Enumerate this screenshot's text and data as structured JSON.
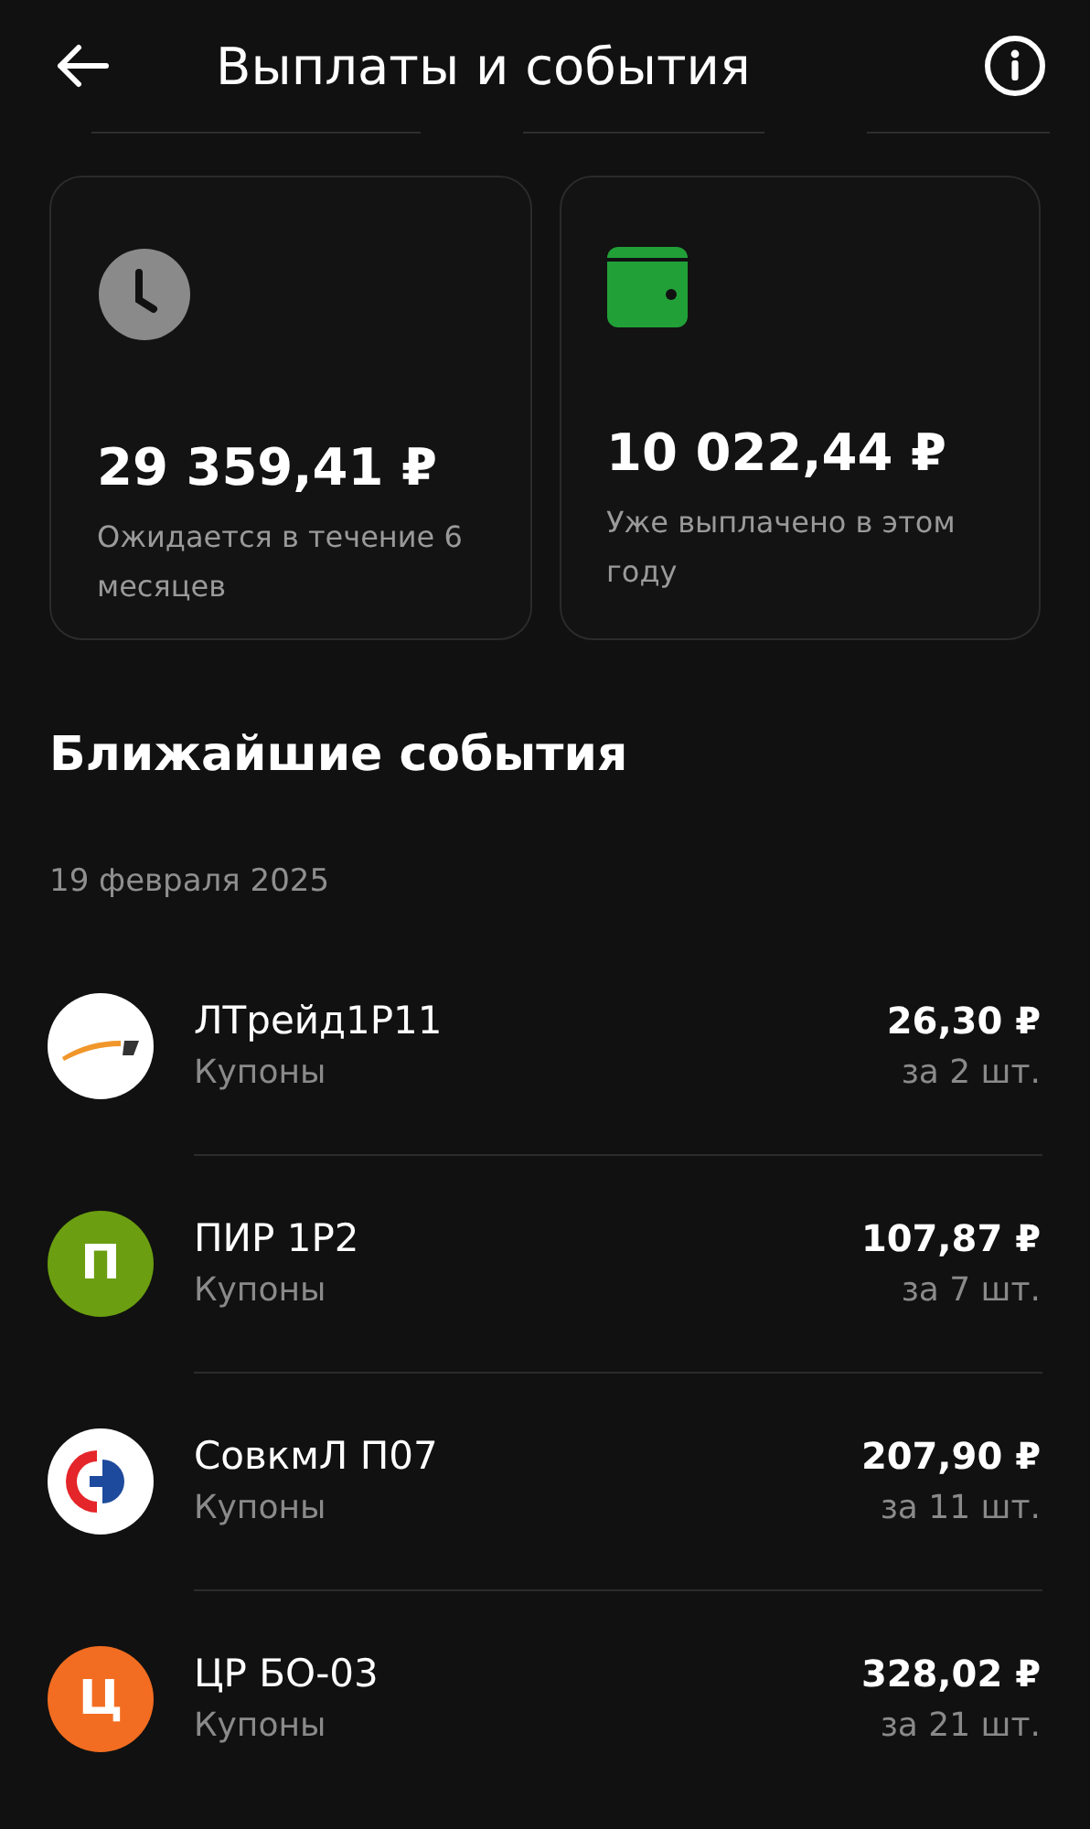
{
  "header": {
    "title": "Выплаты и события"
  },
  "cards": [
    {
      "kind": "clock",
      "amount": "29 359,41 ₽",
      "caption": "Ожидается в течение 6 месяцев"
    },
    {
      "kind": "wallet",
      "amount": "10 022,44 ₽",
      "caption": "Уже выплачено в этом году"
    }
  ],
  "section_title": "Ближайшие события",
  "date": "19 февраля 2025",
  "events": [
    {
      "logo": {
        "kind": "swoosh"
      },
      "name": "ЛТрейд1Р11",
      "type": "Купоны",
      "amount": "26,30 ₽",
      "quantity": "за 2 шт."
    },
    {
      "logo": {
        "kind": "letter",
        "letter": "П",
        "color": "#6b9e10"
      },
      "name": "ПИР 1Р2",
      "type": "Купоны",
      "amount": "107,87 ₽",
      "quantity": "за 7 шт."
    },
    {
      "logo": {
        "kind": "halves"
      },
      "name": "СовкмЛ П07",
      "type": "Купоны",
      "amount": "207,90 ₽",
      "quantity": "за 11 шт."
    },
    {
      "logo": {
        "kind": "letter",
        "letter": "Ц",
        "color": "#f26d21"
      },
      "name": "ЦР БО-03",
      "type": "Купоны",
      "amount": "328,02 ₽",
      "quantity": "за 21 шт."
    }
  ]
}
